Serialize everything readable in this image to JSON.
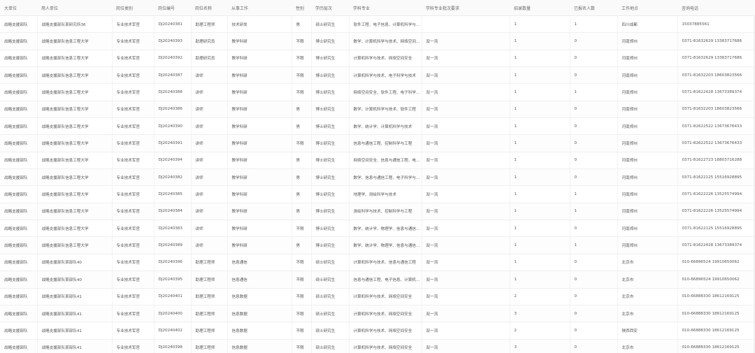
{
  "table": {
    "headers": [
      "大单位",
      "用人单位",
      "岗位类别",
      "岗位编号",
      "岗位名称",
      "从事工作",
      "性别",
      "学历层次",
      "学科专业",
      "学科专业批次要求",
      "招录数量",
      "已报名人数",
      "工作地点",
      "咨询电话"
    ],
    "rows": [
      [
        "战略支援部队",
        "战略支援部队某研究所36",
        "专业技术军官",
        "DJ20240381",
        "助理工程师",
        "技术研发",
        "男",
        "硕士研究生",
        "软件工程、电子信息、计算机科学与技术",
        "",
        "1",
        "1",
        "四川成都",
        "15037885561"
      ],
      [
        "战略支援部队",
        "战略支援部队信息工程大学",
        "专业技术军官",
        "DJ20240393",
        "助理研究员",
        "教学科研",
        "不限",
        "博士研究生",
        "数学、计算机科学与技术、网络空间安全",
        "双一流",
        "1",
        "0",
        "河南郑州",
        "0371-81632629 13383717686"
      ],
      [
        "战略支援部队",
        "战略支援部队信息工程大学",
        "专业技术军官",
        "DJ20240392",
        "助理研究员",
        "教学科研",
        "不限",
        "博士研究生",
        "计算机科学与技术、网络空间安全",
        "双一流",
        "1",
        "0",
        "河南郑州",
        "0371-81632629 13383717686"
      ],
      [
        "战略支援部队",
        "战略支援部队信息工程大学",
        "专业技术军官",
        "DJ20240387",
        "讲师",
        "教学科研",
        "不限",
        "博士研究生",
        "计算机科学与技术、电子科学与技术",
        "双一流",
        "1",
        "0",
        "河南郑州",
        "0371-81632203 18603823566"
      ],
      [
        "战略支援部队",
        "战略支援部队信息工程大学",
        "专业技术军官",
        "DJ20240388",
        "讲师",
        "教学科研",
        "不限",
        "博士研究生",
        "网络空间安全、软件工程、电子科学与技术",
        "双一流",
        "1",
        "1",
        "河南郑州",
        "0371-81622428 13673389374"
      ],
      [
        "战略支援部队",
        "战略支援部队信息工程大学",
        "专业技术军官",
        "DJ20240386",
        "讲师",
        "教学科研",
        "男",
        "博士研究生",
        "数学、计算机科学与技术、软件工程",
        "双一流",
        "1",
        "0",
        "河南郑州",
        "0371-81632203 18603823566"
      ],
      [
        "战略支援部队",
        "战略支援部队信息工程大学",
        "专业技术军官",
        "DJ20240390",
        "讲师",
        "教学科研",
        "男",
        "博士研究生",
        "数学、统计学、计算机科学与技术",
        "双一流",
        "1",
        "0",
        "河南郑州",
        "0371-82622522 13673676433"
      ],
      [
        "战略支援部队",
        "战略支援部队信息工程大学",
        "专业技术军官",
        "DJ20240391",
        "讲师",
        "教学科研",
        "不限",
        "博士研究生",
        "信息与通信工程、控制科学与工程",
        "双一流",
        "1",
        "0",
        "河南郑州",
        "0371-82622522 13673676433"
      ],
      [
        "战略支援部队",
        "战略支援部队信息工程大学",
        "专业技术军官",
        "DJ20240394",
        "讲师",
        "教学科研",
        "男",
        "博士研究生",
        "网络空间安全、信息与通信工程、电子科学与技术",
        "双一流",
        "1",
        "0",
        "河南郑州",
        "0371-81622723 18803716288"
      ],
      [
        "战略支援部队",
        "战略支援部队信息工程大学",
        "专业技术军官",
        "DJ20240382",
        "讲师",
        "教学科研",
        "男",
        "博士研究生",
        "数学、信息与通信工程、电子科学与技术",
        "双一流",
        "1",
        "0",
        "河南郑州",
        "0371-81622125 15516928895"
      ],
      [
        "战略支援部队",
        "战略支援部队信息工程大学",
        "专业技术军官",
        "DJ20240385",
        "讲师",
        "教学科研",
        "男",
        "博士研究生",
        "地理学、测绘科学与技术",
        "双一流",
        "1",
        "1",
        "河南郑州",
        "0371-81622226 13525574994"
      ],
      [
        "战略支援部队",
        "战略支援部队信息工程大学",
        "专业技术军官",
        "DJ20240384",
        "讲师",
        "教学科研",
        "男",
        "博士研究生",
        "测绘科学与技术、控制科学与工程",
        "双一流",
        "1",
        "1",
        "河南郑州",
        "0371-81622226 13525574994"
      ],
      [
        "战略支援部队",
        "战略支援部队信息工程大学",
        "专业技术军官",
        "DJ20240383",
        "讲师",
        "教学科研",
        "不限",
        "博士研究生",
        "数学、统计学、物理学、信息与通信工程",
        "双一流",
        "1",
        "0",
        "河南郑州",
        "0371-81622125 15516928895"
      ],
      [
        "战略支援部队",
        "战略支援部队信息工程大学",
        "专业技术军官",
        "DJ20240389",
        "讲师",
        "教学科研",
        "男",
        "博士研究生",
        "数学、统计学、物理学、信息与通信工程",
        "双一流",
        "1",
        "1",
        "河南郑州",
        "0371-81622428 13673389374"
      ],
      [
        "战略支援部队",
        "战略支援部队某部队40",
        "专业技术军官",
        "DJ20240396",
        "助理工程师",
        "信息通信",
        "不限",
        "硕士研究生",
        "计算机科学与技术、信息与通信工程",
        "双一流",
        "1",
        "0",
        "北京市",
        "010-66896524 19910650062"
      ],
      [
        "战略支援部队",
        "战略支援部队某部队40",
        "专业技术军官",
        "DJ20240395",
        "助理工程师",
        "信息通信",
        "不限",
        "硕士研究生",
        "信息与通信工程、电子信息、计算机科学与技术",
        "双一流",
        "1",
        "0",
        "北京市",
        "010-66896524 19910650062"
      ],
      [
        "战略支援部队",
        "战略支援部队某部队41",
        "专业技术军官",
        "DJ20240401",
        "助理工程师",
        "信息数据",
        "不限",
        "硕士研究生",
        "计算机科学与技术、网络空间安全",
        "双一流",
        "2",
        "0",
        "北京市",
        "010-66888330 18612169125"
      ],
      [
        "战略支援部队",
        "战略支援部队某部队41",
        "专业技术军官",
        "DJ20240400",
        "助理工程师",
        "信息数据",
        "不限",
        "硕士研究生",
        "计算机科学与技术、网络空间安全",
        "双一流",
        "3",
        "0",
        "北京市",
        "010-66888330 18612169125"
      ],
      [
        "战略支援部队",
        "战略支援部队某部队41",
        "专业技术军官",
        "DJ20240402",
        "助理工程师",
        "信息数据",
        "不限",
        "硕士研究生",
        "计算机科学与技术、网络空间安全",
        "双一流",
        "2",
        "0",
        "陕西西安",
        "010-66888330 18612169125"
      ],
      [
        "战略支援部队",
        "战略支援部队某部队41",
        "专业技术军官",
        "DJ20240398",
        "助理工程师",
        "信息数据",
        "不限",
        "硕士研究生",
        "计算机科学与技术、网络空间安全",
        "双一流",
        "3",
        "0",
        "北京市",
        "010-66888330 18612169125"
      ]
    ]
  }
}
